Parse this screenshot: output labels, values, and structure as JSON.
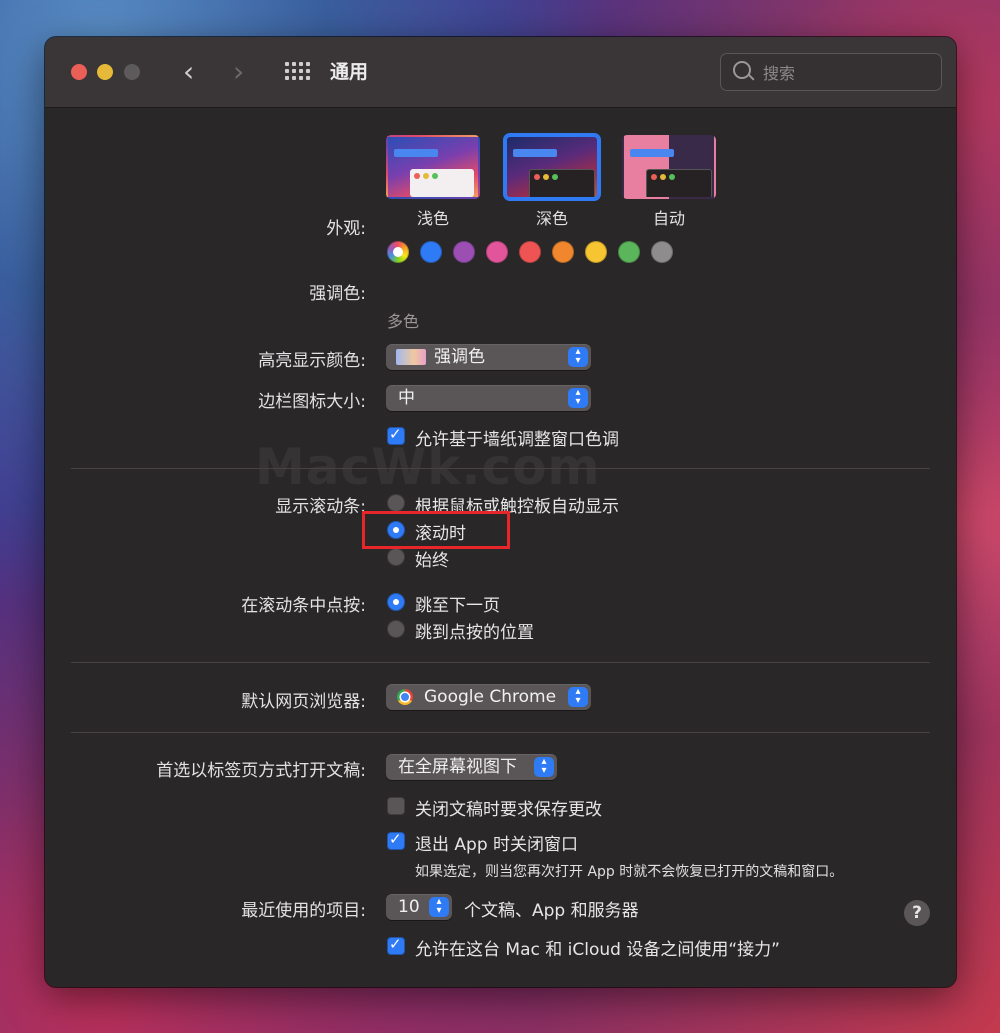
{
  "window": {
    "title": "通用"
  },
  "search": {
    "placeholder": "搜索"
  },
  "appearance": {
    "label": "外观:",
    "options": [
      {
        "name": "浅色",
        "selected": false
      },
      {
        "name": "深色",
        "selected": true
      },
      {
        "name": "自动",
        "selected": false
      }
    ]
  },
  "accent": {
    "label": "强调色:",
    "selected_caption": "多色",
    "colors": [
      "multicolor",
      "#2f7af5",
      "#9b4fb3",
      "#e2559b",
      "#ef5454",
      "#f0862d",
      "#f6c531",
      "#5bb55a",
      "#8e8c8d"
    ]
  },
  "highlight": {
    "label": "高亮显示颜色:",
    "value": "强调色"
  },
  "sidebar_icon": {
    "label": "边栏图标大小:",
    "value": "中"
  },
  "wallpaper_tint": {
    "label": "允许基于墙纸调整窗口色调",
    "checked": true
  },
  "scrollbars": {
    "label": "显示滚动条:",
    "options": [
      {
        "text": "根据鼠标或触控板自动显示",
        "selected": false
      },
      {
        "text": "滚动时",
        "selected": true
      },
      {
        "text": "始终",
        "selected": false
      }
    ]
  },
  "scroll_click": {
    "label": "在滚动条中点按:",
    "options": [
      {
        "text": "跳至下一页",
        "selected": true
      },
      {
        "text": "跳到点按的位置",
        "selected": false
      }
    ]
  },
  "browser": {
    "label": "默认网页浏览器:",
    "value": "Google Chrome"
  },
  "tabs_pref": {
    "label": "首选以标签页方式打开文稿:",
    "value": "在全屏幕视图下"
  },
  "ask_save": {
    "label": "关闭文稿时要求保存更改",
    "checked": false
  },
  "close_windows": {
    "label": "退出 App 时关闭窗口",
    "checked": true,
    "note": "如果选定，则当您再次打开 App 时就不会恢复已打开的文稿和窗口。"
  },
  "recent": {
    "label": "最近使用的项目:",
    "value": "10",
    "suffix": "个文稿、App 和服务器"
  },
  "handoff": {
    "label": "允许在这台 Mac 和 iCloud 设备之间使用“接力”",
    "checked": true
  },
  "help": {
    "symbol": "?"
  },
  "watermark": {
    "text": "MacWk.com"
  }
}
